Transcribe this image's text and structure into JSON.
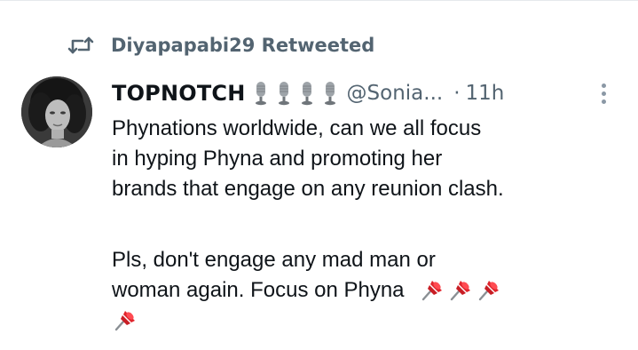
{
  "retweet": {
    "icon": "retweet-icon",
    "label": "Diyapapabi29 Retweeted"
  },
  "author": {
    "avatar": "profile-photo",
    "display_name": "TOPNOTCH",
    "name_emojis": [
      "studio-microphone-icon",
      "studio-microphone-icon",
      "studio-microphone-icon",
      "studio-microphone-icon"
    ],
    "handle": "@Sonia...",
    "separator": "·",
    "time": "11h"
  },
  "more_menu": {
    "icon": "more-vertical-icon"
  },
  "tweet": {
    "lines_p1": [
      "Phynations worldwide, can we all focus",
      "in hyping Phyna and promoting her",
      "brands that engage on any reunion clash."
    ],
    "lines_p2": [
      "Pls, don't engage any mad man or",
      "woman again. Focus on Phyna"
    ],
    "trailing_emojis": [
      "pushpin-icon",
      "pushpin-icon",
      "pushpin-icon",
      "pushpin-icon"
    ]
  },
  "colors": {
    "text_primary": "#0f1419",
    "text_secondary": "#536471",
    "pin_red": "#e0242c"
  }
}
